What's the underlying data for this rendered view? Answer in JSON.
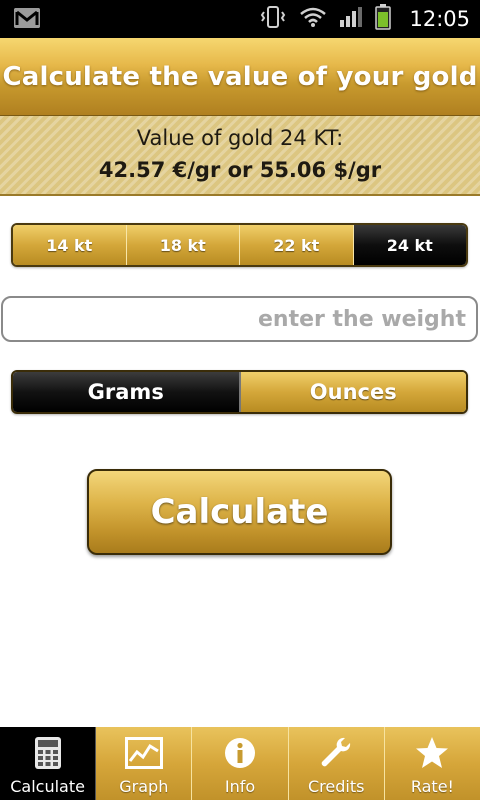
{
  "status_bar": {
    "time": "12:05",
    "icons": [
      "gmail-notification-icon",
      "vibrate-icon",
      "wifi-icon",
      "signal-icon",
      "battery-icon"
    ]
  },
  "header": {
    "title": "Calculate the value of your gold"
  },
  "value_panel": {
    "line1": "Value of gold 24 KT:",
    "line2": "42.57 €/gr or 55.06 $/gr"
  },
  "karat_selector": {
    "options": [
      "14 kt",
      "18 kt",
      "22 kt",
      "24 kt"
    ],
    "selected": "24 kt"
  },
  "weight_input": {
    "placeholder": "enter the weight",
    "value": ""
  },
  "unit_selector": {
    "options": [
      "Grams",
      "Ounces"
    ],
    "selected": "Grams"
  },
  "calculate_button": {
    "label": "Calculate"
  },
  "tabs": [
    {
      "label": "Calculate",
      "icon": "calculator-icon",
      "active": true
    },
    {
      "label": "Graph",
      "icon": "graph-icon",
      "active": false
    },
    {
      "label": "Info",
      "icon": "info-icon",
      "active": false
    },
    {
      "label": "Credits",
      "icon": "wrench-icon",
      "active": false
    },
    {
      "label": "Rate!",
      "icon": "star-icon",
      "active": false
    }
  ],
  "colors": {
    "gold_light": "#f0cf6a",
    "gold_mid": "#d4a73a",
    "gold_dark": "#b88c22",
    "selected_black": "#000000"
  }
}
